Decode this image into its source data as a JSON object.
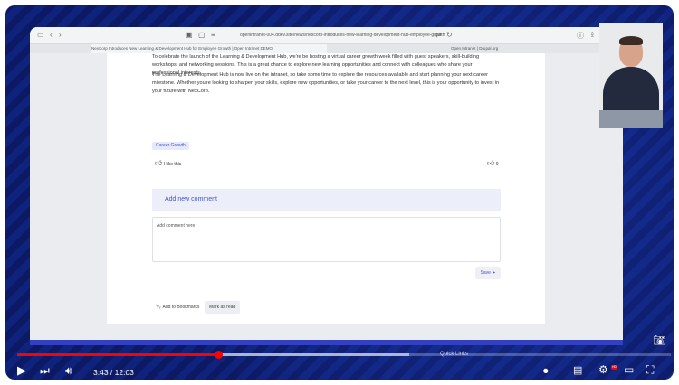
{
  "browser": {
    "url": "openintranet-004.ddev.site/news/nexcorp-introduces-new-learning-development-hub-employee-growth",
    "tabs": [
      "NexCorp Introduces New Learning & Development Hub for Employee Growth | Open Intranet DEMO",
      "Open Intranet | Drupal.org"
    ]
  },
  "article": {
    "para1": "To celebrate the launch of the Learning & Development Hub, we're be hosting a virtual career growth week filled with guest speakers, skill-building workshops, and networking sessions. This is a great chance to explore new learning opportunities and connect with colleagues who share your professional interests.",
    "para2": "The Learning & Development Hub is now live on the intranet, so take some time to explore the resources available and start planning your next career milestone. Whether you're looking to sharpen your skills, explore new opportunities, or take your career to the next level, this is your opportunity to invest in your future with NexCorp.",
    "tag": "Career Growth",
    "like_label": "I like this",
    "like_count": "0"
  },
  "comments": {
    "heading": "Add new comment",
    "placeholder": "Add comment here",
    "save_label": "Save"
  },
  "actions": {
    "bookmark_label": "Add to Bookmarks",
    "mark_read_label": "Mark as read"
  },
  "footer": {
    "quick_links": "Quick Links"
  },
  "player": {
    "current_time": "3:43",
    "duration": "12:03",
    "time_display": "3:43 / 12:03",
    "played_fraction": 0.308,
    "buffered_fraction": 0.6,
    "hd_badge": "HD",
    "colors": {
      "progress": "#ff0000",
      "page_accent": "#4755c9"
    }
  }
}
